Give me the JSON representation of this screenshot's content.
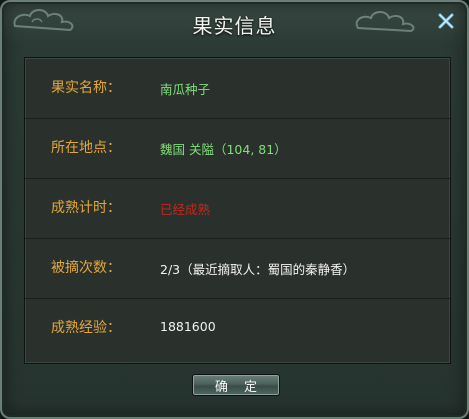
{
  "dialog": {
    "title": "果实信息",
    "close_icon": "close-x-icon",
    "ok_label": "确 定"
  },
  "rows": [
    {
      "label": "果实名称：",
      "value": "南瓜种子",
      "value_color": "#7fe07a"
    },
    {
      "label": "所在地点：",
      "value": "魏国 关隘（104, 81）",
      "value_color": "#7fe07a"
    },
    {
      "label": "成熟计时：",
      "value": "已经成熟",
      "value_color": "#c0281f"
    },
    {
      "label": "被摘次数：",
      "value": "2/3（最近摘取人：蜀国的秦静香）",
      "value_color": "#f2f2f2"
    },
    {
      "label": "成熟经验：",
      "value": "1881600",
      "value_color": "#f2f2f2"
    }
  ],
  "colors": {
    "label": "#e3a73b",
    "panel_bg": "#2a302c",
    "dialog_bg": "#26332f"
  }
}
